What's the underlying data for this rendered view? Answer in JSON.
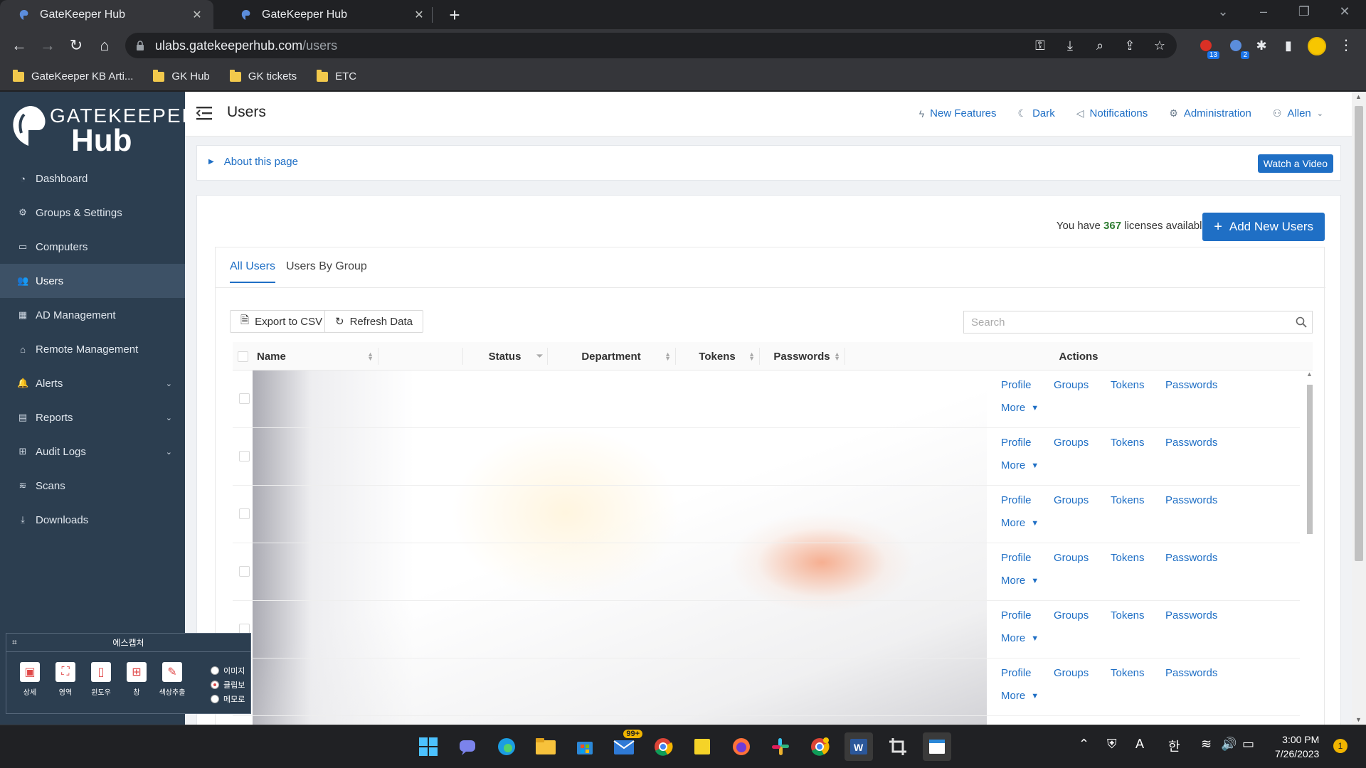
{
  "browser": {
    "tabs": [
      {
        "title": "GateKeeper Hub",
        "active": true
      },
      {
        "title": "GateKeeper Hub",
        "active": false
      }
    ],
    "url_host": "ulabs.gatekeeperhub.com",
    "url_path": "/users",
    "extension_badges": [
      "13",
      "2"
    ],
    "bookmarks": [
      "GateKeeper KB Arti...",
      "GK Hub",
      "GK tickets",
      "ETC"
    ]
  },
  "sidebar": {
    "brand_top": "GATEKEEPER",
    "brand_bottom": "Hub",
    "items": [
      {
        "label": "Dashboard",
        "icon": "dashboard-icon"
      },
      {
        "label": "Groups & Settings",
        "icon": "gears-icon"
      },
      {
        "label": "Computers",
        "icon": "laptop-icon"
      },
      {
        "label": "Users",
        "icon": "users-icon",
        "active": true
      },
      {
        "label": "AD Management",
        "icon": "grid-icon"
      },
      {
        "label": "Remote Management",
        "icon": "bank-icon"
      },
      {
        "label": "Alerts",
        "icon": "bell-icon",
        "expandable": true
      },
      {
        "label": "Reports",
        "icon": "report-icon",
        "expandable": true
      },
      {
        "label": "Audit Logs",
        "icon": "table-icon",
        "expandable": true
      },
      {
        "label": "Scans",
        "icon": "wifi-icon"
      },
      {
        "label": "Downloads",
        "icon": "download-icon"
      }
    ]
  },
  "header": {
    "title": "Users",
    "links": {
      "new_features": "New Features",
      "dark": "Dark",
      "notifications": "Notifications",
      "administration": "Administration",
      "user": "Allen"
    }
  },
  "about": {
    "title": "About this page",
    "watch_video": "Watch a Video"
  },
  "licenses": {
    "prefix": "You have",
    "count": "367",
    "suffix": "licenses available."
  },
  "add_users_label": "Add New Users",
  "tabs": {
    "all_users": "All Users",
    "users_by_group": "Users By Group"
  },
  "toolbar": {
    "export_csv": "Export to CSV",
    "refresh": "Refresh Data",
    "search_placeholder": "Search"
  },
  "table": {
    "columns": {
      "name": "Name",
      "status": "Status",
      "department": "Department",
      "tokens": "Tokens",
      "passwords": "Passwords",
      "actions": "Actions"
    },
    "row_actions": {
      "profile": "Profile",
      "groups": "Groups",
      "tokens": "Tokens",
      "passwords": "Passwords",
      "more": "More"
    },
    "row_count_visible": 6
  },
  "capture_tool": {
    "title": "에스캡처",
    "tools": [
      "상세",
      "영역",
      "윈도우",
      "창",
      "색상추출"
    ],
    "options": [
      "이미지",
      "클립보",
      "메모로"
    ]
  },
  "taskbar": {
    "mail_badge": "99+",
    "time": "3:00 PM",
    "date": "7/26/2023",
    "notifications": "1",
    "ime": "한"
  },
  "colors": {
    "accent": "#1f6fc5",
    "sidebar": "#2c3e50",
    "sidebar_active": "#3d5166",
    "license_count": "#2e7d32"
  }
}
